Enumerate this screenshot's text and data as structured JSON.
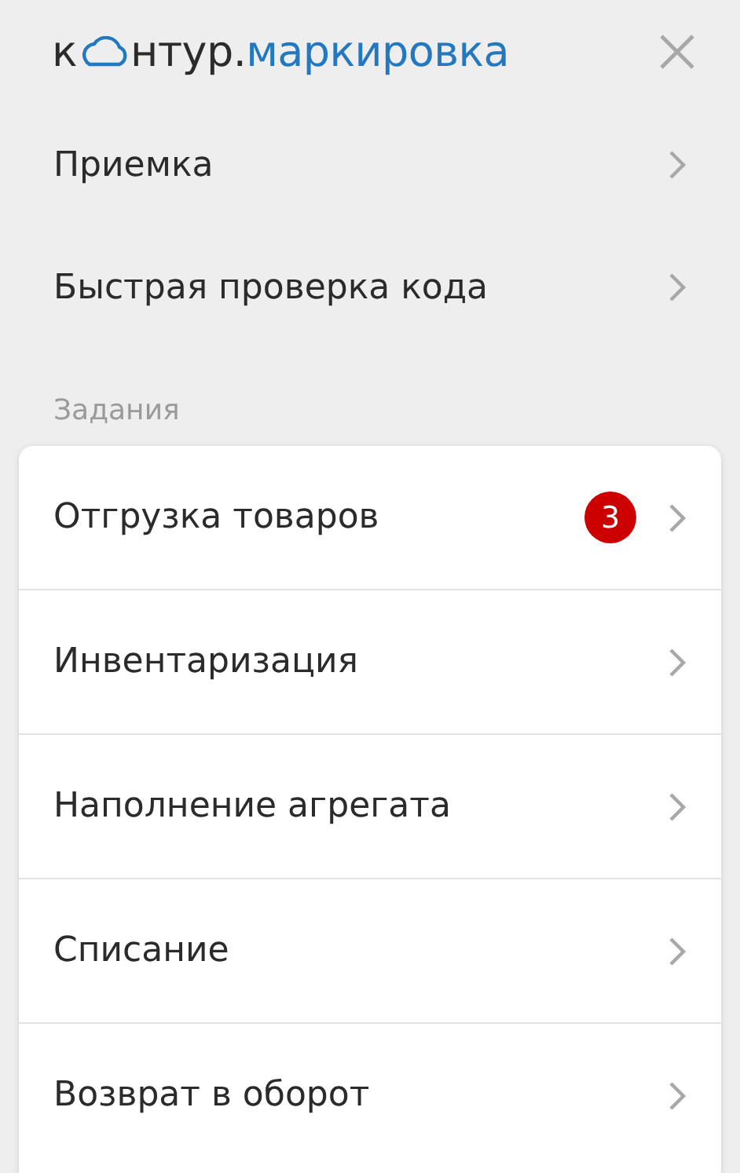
{
  "header": {
    "logo": {
      "prefix": "к",
      "suffix": "нтур.",
      "product": "маркировка"
    }
  },
  "top_items": [
    {
      "label": "Приемка"
    },
    {
      "label": "Быстрая проверка кода"
    }
  ],
  "section": {
    "title": "Задания",
    "items": [
      {
        "label": "Отгрузка товаров",
        "badge": "3"
      },
      {
        "label": "Инвентаризация"
      },
      {
        "label": "Наполнение агрегата"
      },
      {
        "label": "Списание"
      },
      {
        "label": "Возврат в оборот"
      }
    ]
  }
}
